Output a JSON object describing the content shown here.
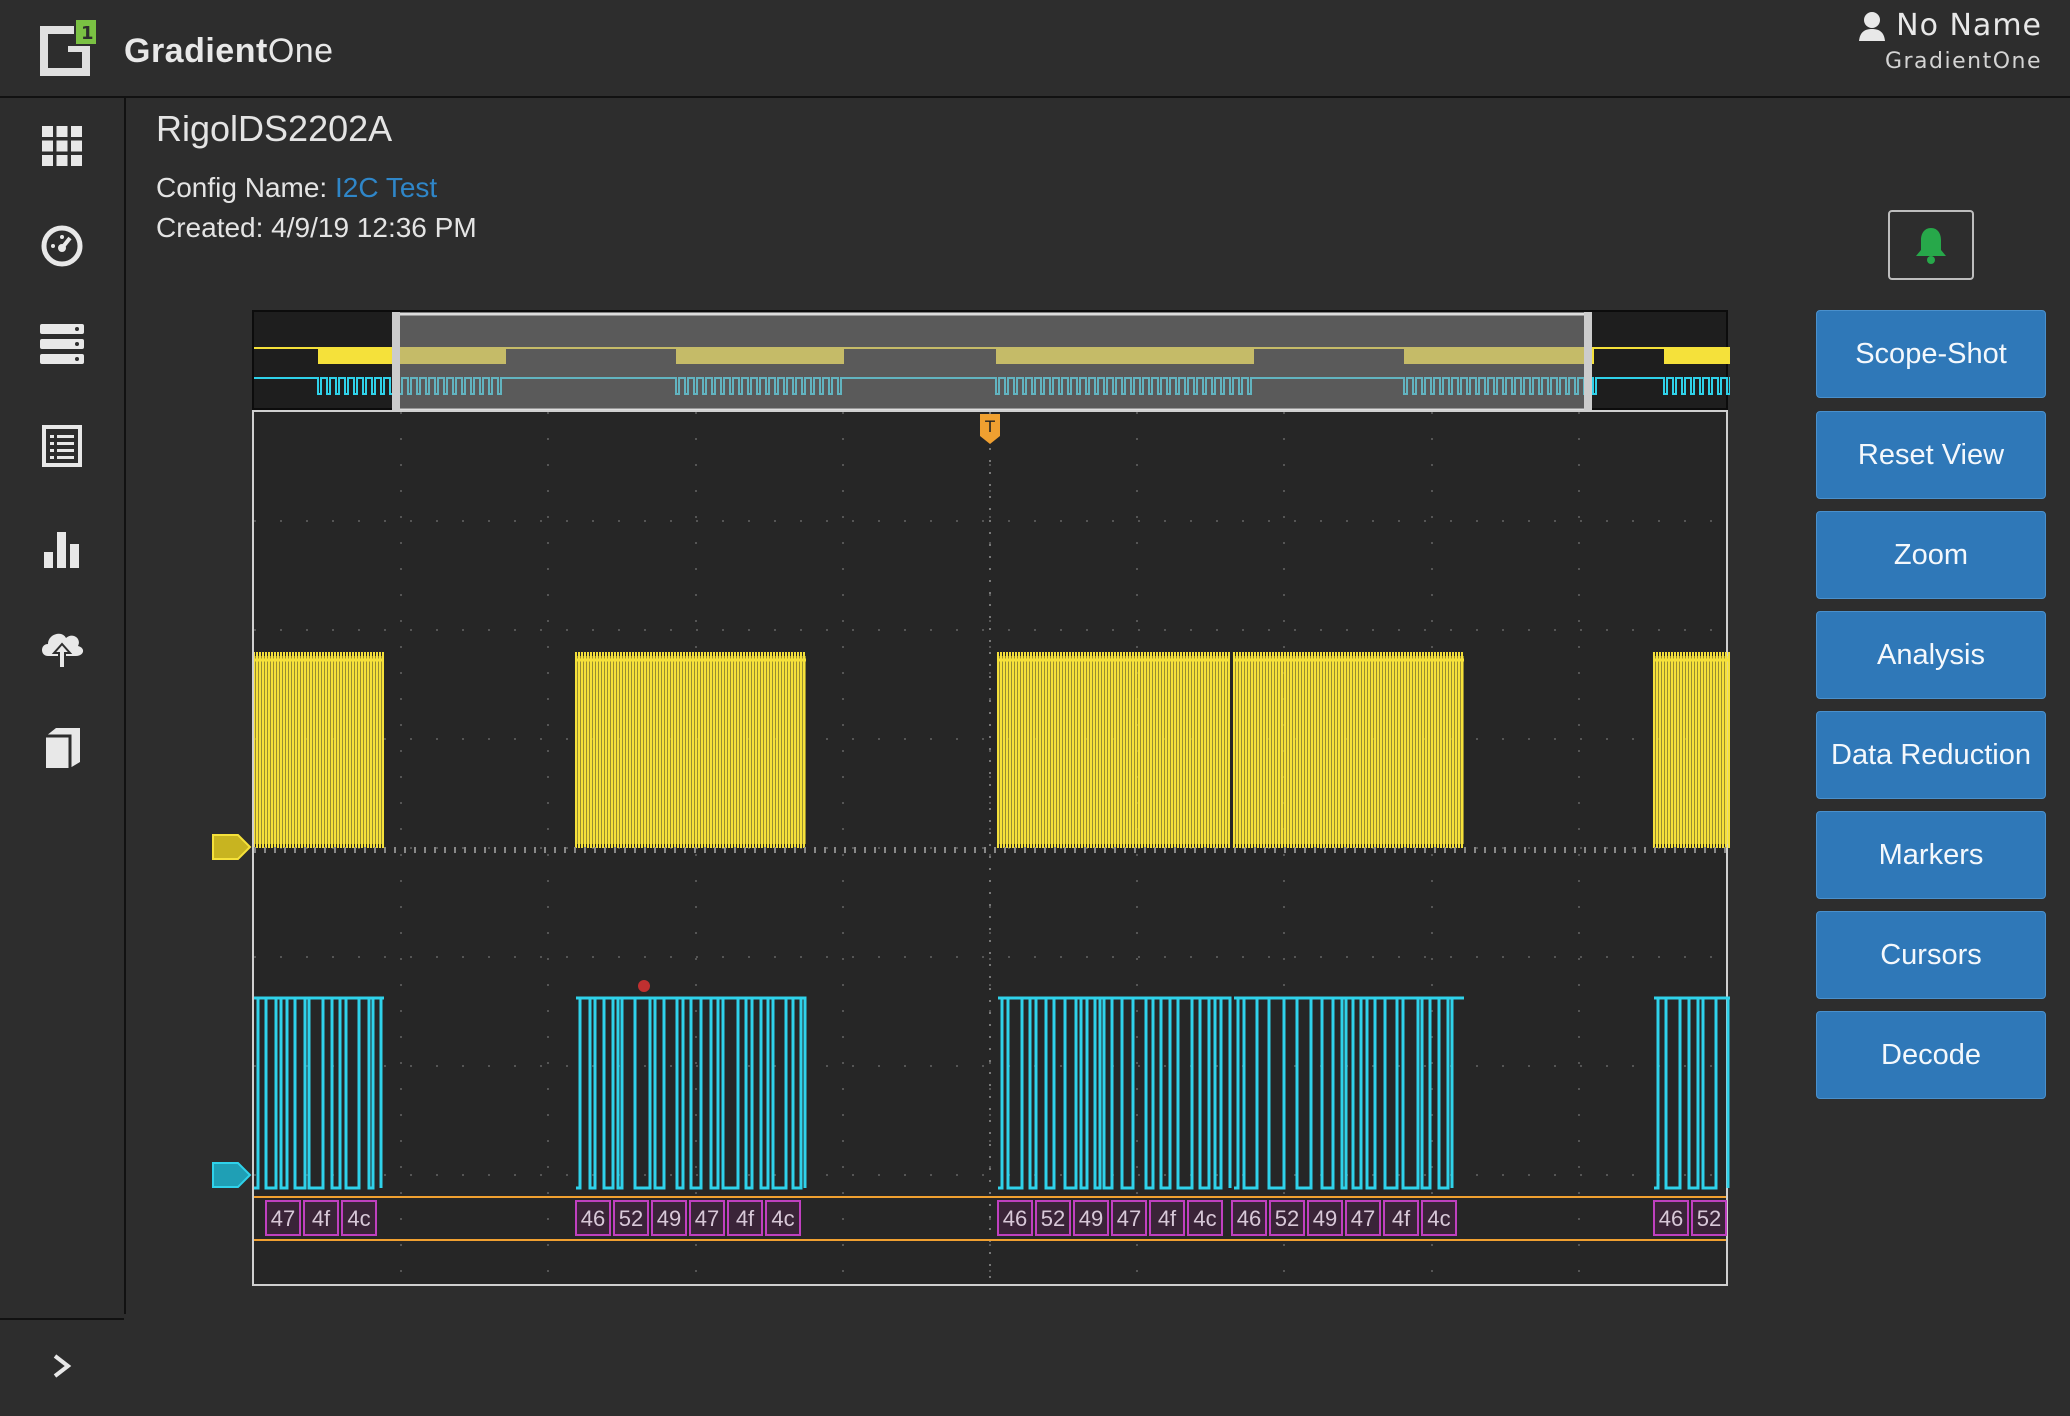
{
  "brand": {
    "name_bold": "Gradient",
    "name_light": "One"
  },
  "user": {
    "name": "No Name",
    "org": "GradientOne"
  },
  "sidebar": {
    "items": [
      {
        "icon": "grid-icon",
        "label": "apps"
      },
      {
        "icon": "dashboard-gauge-icon",
        "label": "dashboard"
      },
      {
        "icon": "server-icon",
        "label": "instruments"
      },
      {
        "icon": "list-icon",
        "label": "results"
      },
      {
        "icon": "bar-chart-icon",
        "label": "analytics"
      },
      {
        "icon": "cloud-upload-icon",
        "label": "upload"
      },
      {
        "icon": "book-icon",
        "label": "docs"
      }
    ],
    "expand_icon": "chevron-right-icon"
  },
  "device": {
    "title": "RigolDS2202A",
    "config_label": "Config Name:",
    "config_value": "I2C Test",
    "created": "Created: 4/9/19 12:36 PM"
  },
  "actions": [
    "Scope-Shot",
    "Reset View",
    "Zoom",
    "Analysis",
    "Data Reduction",
    "Markers",
    "Cursors",
    "Decode"
  ],
  "notification": {
    "icon": "bell-icon",
    "color": "#27a84a"
  },
  "scope": {
    "trigger_label": "T",
    "channel_colors": {
      "ch1": "#f5e13a",
      "ch2": "#2fd2ea",
      "decode": "#c040c0",
      "trigger": "#f0a030"
    },
    "decode_groups": [
      {
        "bytes": [
          "47",
          "4f",
          "4c"
        ]
      },
      {
        "bytes": [
          "46",
          "52",
          "49",
          "47",
          "4f",
          "4c"
        ]
      },
      {
        "bytes": [
          "46",
          "52",
          "49",
          "47",
          "4f",
          "4c"
        ]
      },
      {
        "bytes": [
          "46",
          "52",
          "49",
          "47",
          "4f",
          "4c"
        ]
      },
      {
        "bytes": [
          "46",
          "52"
        ]
      }
    ]
  }
}
